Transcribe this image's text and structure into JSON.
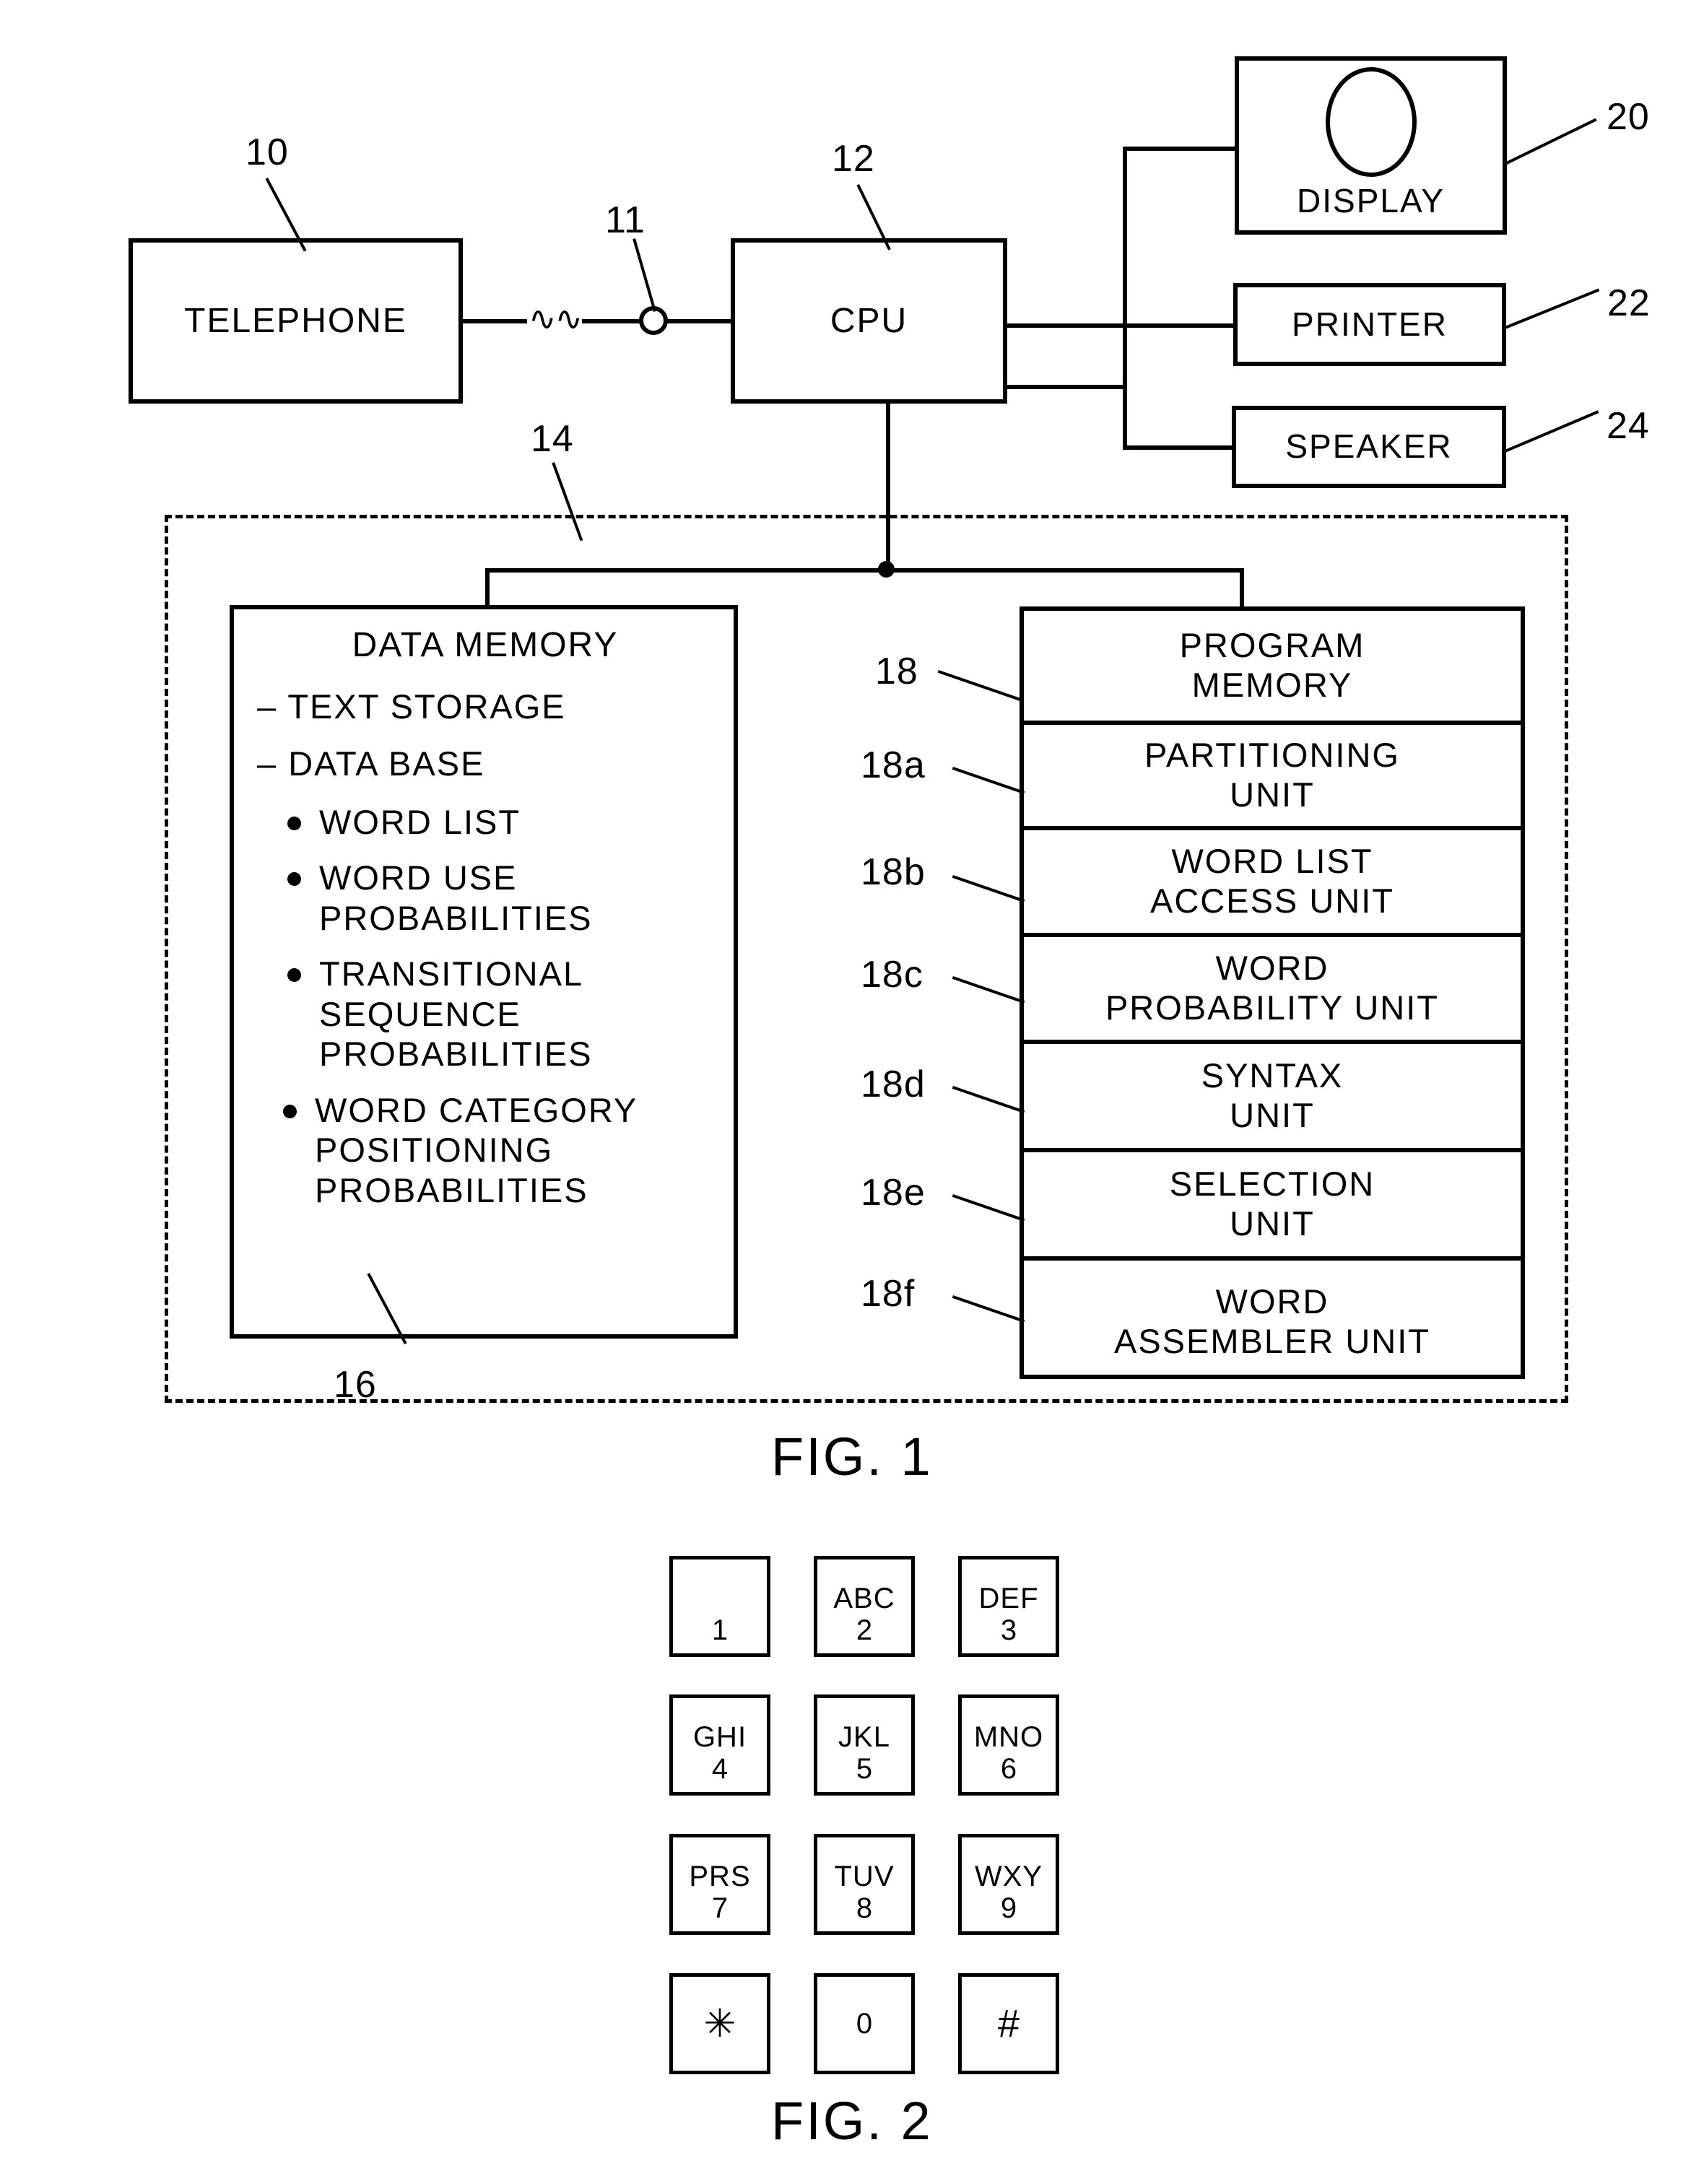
{
  "figure1": {
    "caption": "FIG. 1",
    "blocks": {
      "telephone": {
        "label": "TELEPHONE",
        "ref": "10"
      },
      "node": {
        "ref": "11"
      },
      "cpu": {
        "label": "CPU",
        "ref": "12"
      },
      "display": {
        "label": "DISPLAY",
        "ref": "20",
        "icon": "crt-screen-ellipse"
      },
      "printer": {
        "label": "PRINTER",
        "ref": "22"
      },
      "speaker": {
        "label": "SPEAKER",
        "ref": "24"
      },
      "memory_region": {
        "ref": "14"
      },
      "data_memory": {
        "ref": "16",
        "title": "DATA MEMORY",
        "dash_items": [
          "– TEXT STORAGE",
          "– DATA BASE"
        ],
        "bullet_items": [
          "WORD LIST",
          "WORD USE\nPROBABILITIES",
          "TRANSITIONAL\nSEQUENCE\nPROBABILITIES",
          "WORD CATEGORY\nPOSITIONING\nPROBABILITIES"
        ]
      },
      "program_memory": {
        "rows": [
          {
            "ref": "18",
            "label": "PROGRAM\nMEMORY"
          },
          {
            "ref": "18a",
            "label": "PARTITIONING\nUNIT"
          },
          {
            "ref": "18b",
            "label": "WORD LIST\nACCESS UNIT"
          },
          {
            "ref": "18c",
            "label": "WORD\nPROBABILITY UNIT"
          },
          {
            "ref": "18d",
            "label": "SYNTAX\nUNIT"
          },
          {
            "ref": "18e",
            "label": "SELECTION\nUNIT"
          },
          {
            "ref": "18f",
            "label": "WORD\nASSEMBLER UNIT"
          }
        ]
      }
    },
    "break_symbol": "~"
  },
  "figure2": {
    "caption": "FIG. 2",
    "keys": [
      {
        "letters": "",
        "digit": "1",
        "name": "key-1"
      },
      {
        "letters": "ABC",
        "digit": "2",
        "name": "key-2"
      },
      {
        "letters": "DEF",
        "digit": "3",
        "name": "key-3"
      },
      {
        "letters": "GHI",
        "digit": "4",
        "name": "key-4"
      },
      {
        "letters": "JKL",
        "digit": "5",
        "name": "key-5"
      },
      {
        "letters": "MNO",
        "digit": "6",
        "name": "key-6"
      },
      {
        "letters": "PRS",
        "digit": "7",
        "name": "key-7"
      },
      {
        "letters": "TUV",
        "digit": "8",
        "name": "key-8"
      },
      {
        "letters": "WXY",
        "digit": "9",
        "name": "key-9"
      },
      {
        "letters": "",
        "digit": "✳",
        "name": "key-star"
      },
      {
        "letters": "",
        "digit": "0",
        "name": "key-0"
      },
      {
        "letters": "",
        "digit": "#",
        "name": "key-pound"
      }
    ]
  },
  "colors": {
    "ink": "#000000",
    "paper": "#ffffff"
  }
}
